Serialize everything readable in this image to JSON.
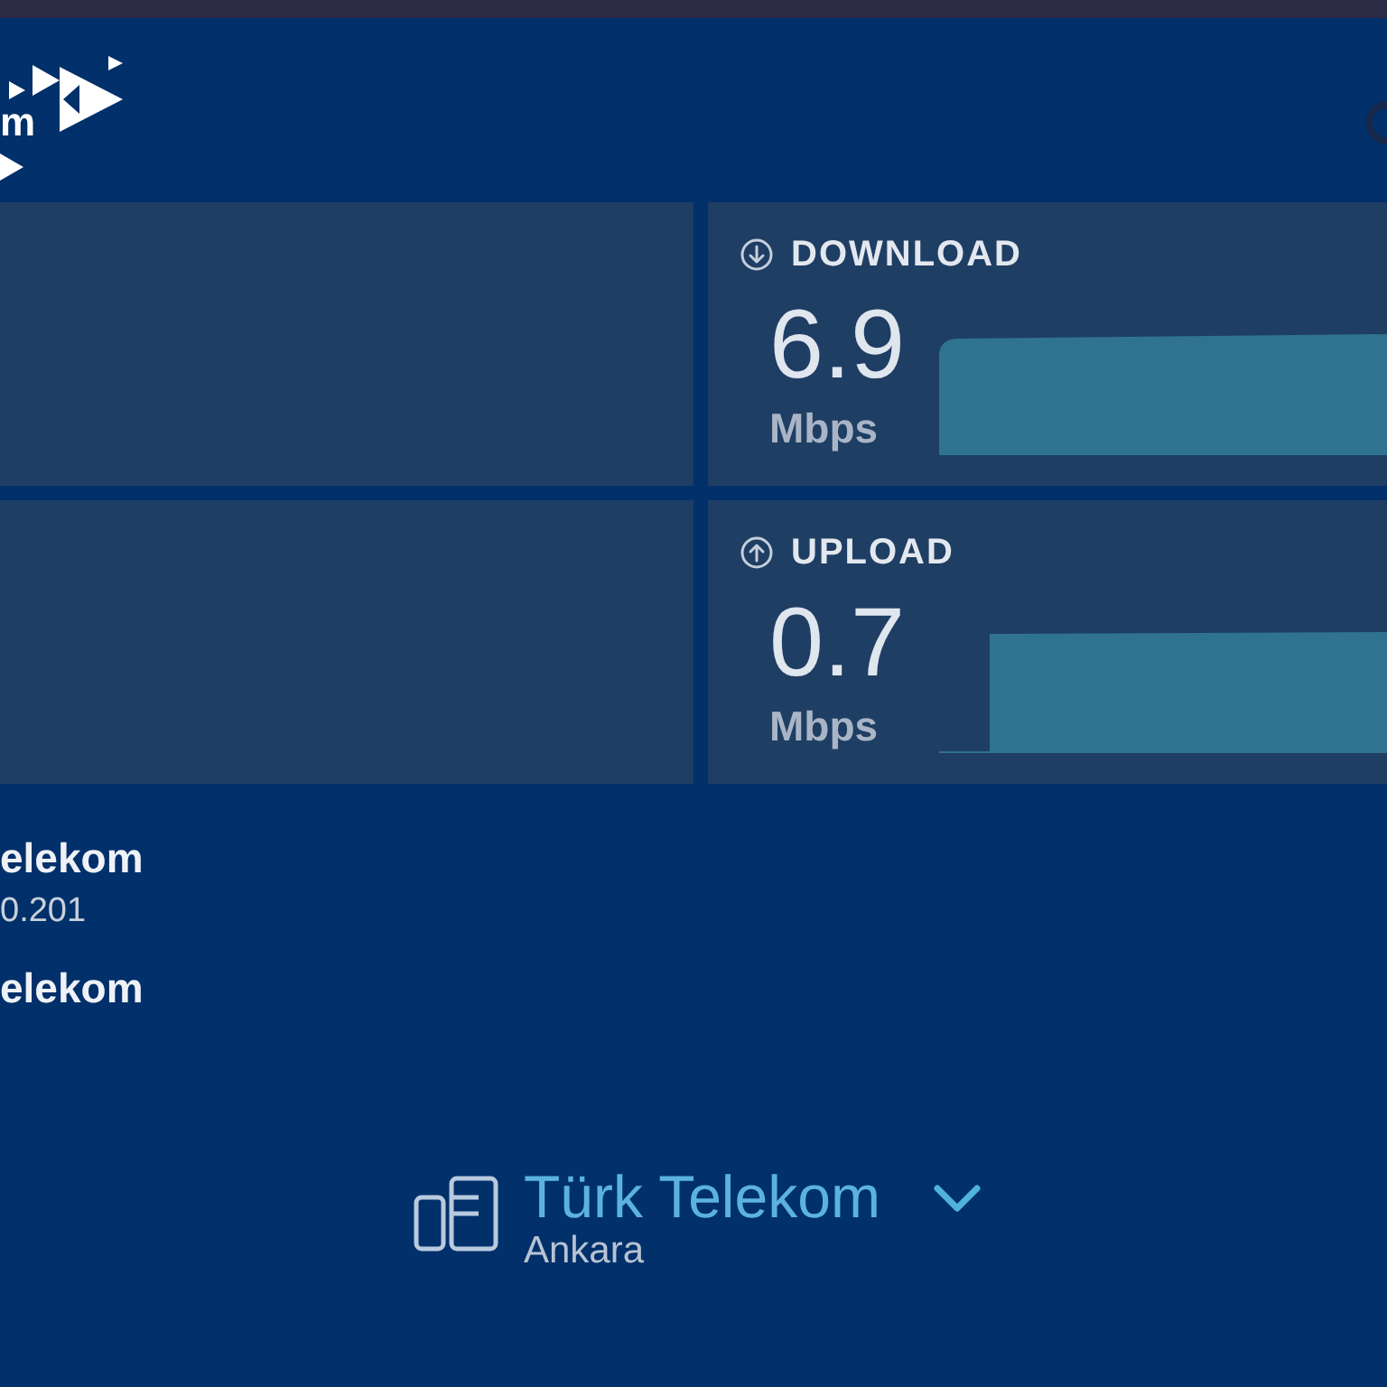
{
  "header": {
    "logo_text": "m"
  },
  "results": [
    {
      "kind": "download",
      "label": "DOWNLOAD",
      "value": "6.9",
      "unit": "Mbps"
    },
    {
      "kind": "upload",
      "label": "UPLOAD",
      "value": "0.7",
      "unit": "Mbps"
    }
  ],
  "connection": [
    {
      "name": "elekom",
      "address": "0.201"
    },
    {
      "name": "elekom"
    }
  ],
  "server": {
    "name": "Türk Telekom",
    "location": "Ankara"
  }
}
